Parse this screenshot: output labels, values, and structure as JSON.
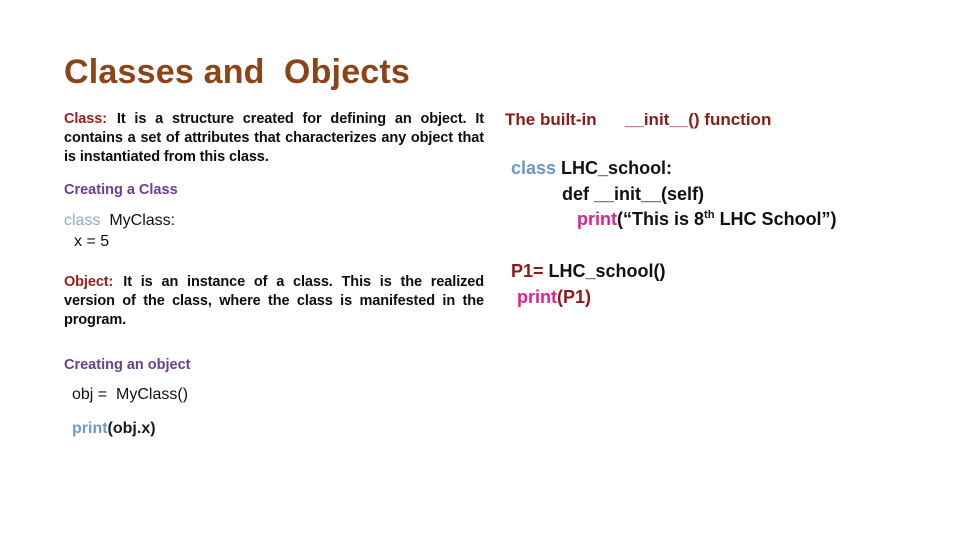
{
  "slide": {
    "title": "Classes and  Objects",
    "background_color": "#ffffff"
  },
  "colors": {
    "title_brown": "#8C4418",
    "term_red": "#9E1B1B",
    "heading_purple": "#6B3E8E",
    "keyword_blue": "#8FAEC4",
    "keyword_blue_right": "#6C98BE",
    "print_pink": "#E0218A",
    "print_blue": "#6E9BC4",
    "body_black": "#0d0d0d"
  },
  "left_column": {
    "class_definition": {
      "term": "Class:",
      "body": "It is a structure created for defining an object. It contains a set of attributes that characterizes any object that is instantiated from this class."
    },
    "creating_a_class": {
      "heading": "Creating a Class",
      "code_keyword": "class",
      "code_rest": "  MyClass:",
      "code_line2": "x = 5"
    },
    "object_definition": {
      "term": "Object:",
      "body": "It is an instance of a class. This is the realized version of the class, where the class is manifested in the program."
    },
    "creating_an_object": {
      "heading": "Creating an object",
      "code_line1": "obj =  MyClass()",
      "print_keyword": "print",
      "print_args": "(obj.x)"
    }
  },
  "right_column": {
    "heading": "The built-in      __init__() function",
    "code": {
      "line1_keyword": "class",
      "line1_rest": " LHC_school:",
      "line2": "def __init__(self)",
      "line3_keyword": "print",
      "line3_part_a": "(“This is 8",
      "line3_sup": "th",
      "line3_part_b": " LHC School”)"
    },
    "instance": {
      "assign_var": "P1=",
      "assign_value": " LHC_school()",
      "print_keyword": "print",
      "print_args": "(P1)"
    }
  }
}
